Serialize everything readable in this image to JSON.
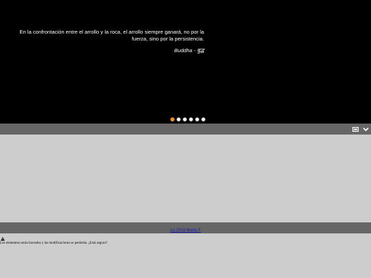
{
  "hero": {
    "quote": "En la confrontación entre el arrollo y la roca, el arrollo siempre ganará, no por la fuerza, sino por la persistencia.",
    "author": "Buddha - बुद्ध",
    "slides": [
      {
        "active": true
      },
      {
        "active": false
      },
      {
        "active": false
      },
      {
        "active": false
      },
      {
        "active": false
      },
      {
        "active": false
      }
    ]
  },
  "toolbar": {
    "icons": [
      "window-icon",
      "chevron-down-icon"
    ]
  },
  "footer": {
    "copyright": "(c) 2016 Marta F"
  },
  "warning": {
    "icon": "warning-icon",
    "text": "Los elementos serán borrados y las modificaciones se perderán. ¿Está seguro?"
  },
  "colors": {
    "hero_bg": "#000000",
    "bar_bg": "#666666",
    "content_bg": "#cdcdcd",
    "active_dot": "#f08a24",
    "link": "#1a1aa6"
  }
}
